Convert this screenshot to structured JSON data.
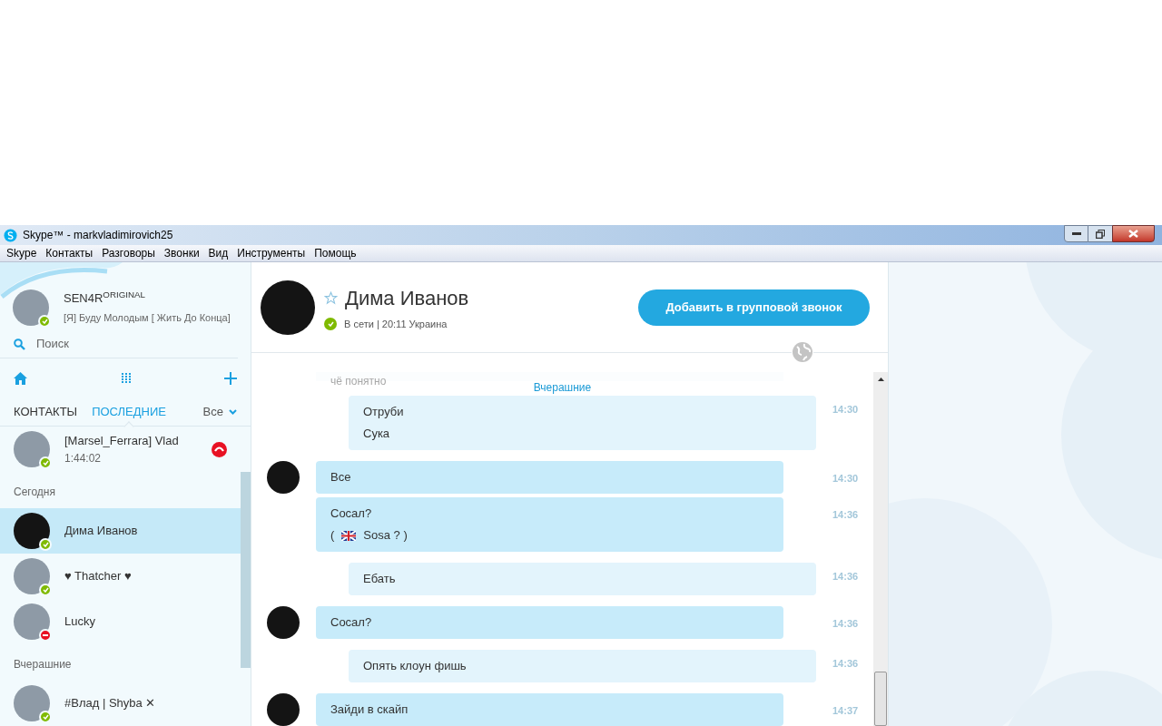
{
  "window": {
    "title": "Skype™ - markvladimirovich25"
  },
  "menu": [
    "Skype",
    "Контакты",
    "Разговоры",
    "Звонки",
    "Вид",
    "Инструменты",
    "Помощь"
  ],
  "profile": {
    "name": "SEN4R$^{ORIGINAL}$",
    "mood": "[Я] Буду Молодым [ Жить До Конца]",
    "color": "#7fba00"
  },
  "search": {
    "placeholder": "Поиск"
  },
  "tabs": [
    {
      "label": "КОНТАКТЫ",
      "selected": false
    },
    {
      "label": "ПОСЛЕДНИЕ",
      "selected": true
    }
  ],
  "filter": {
    "label": "Все"
  },
  "recent": [
    {
      "kind": "call",
      "name": "[Marsel_Ferrara] Vlad",
      "duration": "1:44:02",
      "color": "#7fba00",
      "busy": false,
      "photo": true
    },
    {
      "kind": "header",
      "label": "Сегодня"
    },
    {
      "kind": "contact",
      "name": "Дима Иванов",
      "color": "#7fba00",
      "busy": false,
      "photo": false,
      "selected": true
    },
    {
      "kind": "contact",
      "name": "♥ Thatcher ♥",
      "color": "#7fba00",
      "busy": false,
      "photo": true,
      "selected": false
    },
    {
      "kind": "contact",
      "name": "Lucky",
      "color": "#e81123",
      "busy": true,
      "photo": true,
      "selected": false
    },
    {
      "kind": "header",
      "label": "Вчерашние"
    },
    {
      "kind": "contact",
      "name": "#Влад | Shyba ✕",
      "color": "#7fba00",
      "busy": false,
      "photo": true,
      "selected": false
    }
  ],
  "chat": {
    "contact": {
      "name": "Дима Иванов",
      "favorite": false,
      "color": "#7fba00",
      "status_text": "В сети | 20:11 Украина"
    },
    "call_button": "Добавить в групповой звонок",
    "faded_message": "чё понятно",
    "date_separator": "Вчерашние",
    "messages": [
      {
        "kind": "outgoing",
        "lines": [
          "Отруби",
          "Сука"
        ],
        "time": "14:30"
      },
      {
        "kind": "incoming",
        "avatar": true,
        "lines": [
          "Все"
        ],
        "time": "14:30"
      },
      {
        "kind": "incoming",
        "avatar": false,
        "lines": [
          "Сосал?"
        ],
        "translation": {
          "open": "(",
          "text": "Sosa ? )"
        },
        "time": "14:36"
      },
      {
        "kind": "outgoing",
        "lines": [
          "Ебать"
        ],
        "time": "14:36"
      },
      {
        "kind": "incoming",
        "avatar": true,
        "lines": [
          "Сосал?"
        ],
        "time": "14:36"
      },
      {
        "kind": "outgoing",
        "lines": [
          "Опять клоун фишь"
        ],
        "time": "14:36"
      },
      {
        "kind": "incoming",
        "avatar": true,
        "lines": [
          "Зайди в скайп"
        ],
        "time": "14:37"
      }
    ]
  }
}
